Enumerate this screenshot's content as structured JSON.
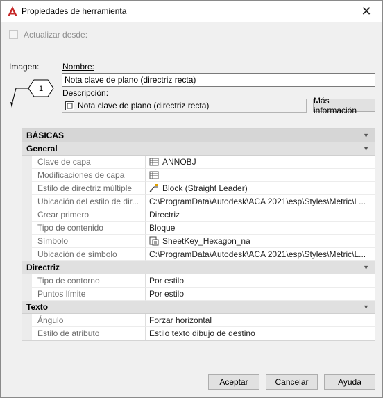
{
  "window": {
    "title": "Propiedades de herramienta",
    "close_glyph": "✕",
    "app_icon": "autocad-logo-icon",
    "accent": "#c62828"
  },
  "update": {
    "checkbox_label": "Actualizar desde:",
    "checked": false
  },
  "image_label": "Imagen:",
  "image": {
    "symbol_number": "1"
  },
  "name": {
    "label": "Nombre:",
    "value": "Nota clave de plano (directriz recta)"
  },
  "description": {
    "label": "Descripción:",
    "value": "Nota clave de plano (directriz recta)",
    "more_button": "Más información"
  },
  "grid": {
    "top_category": "BÁSICAS",
    "sections": [
      {
        "title": "General",
        "props": [
          {
            "name": "Clave de capa",
            "value": "ANNOBJ",
            "icon": "layer-list-icon"
          },
          {
            "name": "Modificaciones de capa",
            "value": "",
            "icon": "layer-list-icon"
          },
          {
            "name": "Estilo de directriz múltiple",
            "value": "Block (Straight Leader)",
            "icon": "multileader-icon"
          },
          {
            "name": "Ubicación del estilo de dir...",
            "value": "C:\\ProgramData\\Autodesk\\ACA 2021\\esp\\Styles\\Metric\\L...",
            "icon": ""
          },
          {
            "name": "Crear primero",
            "value": "Directriz",
            "icon": ""
          },
          {
            "name": "Tipo de contenido",
            "value": "Bloque",
            "icon": ""
          },
          {
            "name": "Símbolo",
            "value": "SheetKey_Hexagon_na",
            "icon": "block-icon"
          },
          {
            "name": "Ubicación de símbolo",
            "value": "C:\\ProgramData\\Autodesk\\ACA 2021\\esp\\Styles\\Metric\\L...",
            "icon": ""
          }
        ]
      },
      {
        "title": "Directriz",
        "props": [
          {
            "name": "Tipo de contorno",
            "value": "Por estilo",
            "icon": ""
          },
          {
            "name": "Puntos límite",
            "value": "Por estilo",
            "icon": ""
          }
        ]
      },
      {
        "title": "Texto",
        "props": [
          {
            "name": "Ángulo",
            "value": "Forzar horizontal",
            "icon": ""
          },
          {
            "name": "Estilo de atributo",
            "value": "Estilo texto dibujo de destino",
            "icon": ""
          }
        ]
      }
    ]
  },
  "buttons": {
    "ok": "Aceptar",
    "cancel": "Cancelar",
    "help": "Ayuda"
  }
}
